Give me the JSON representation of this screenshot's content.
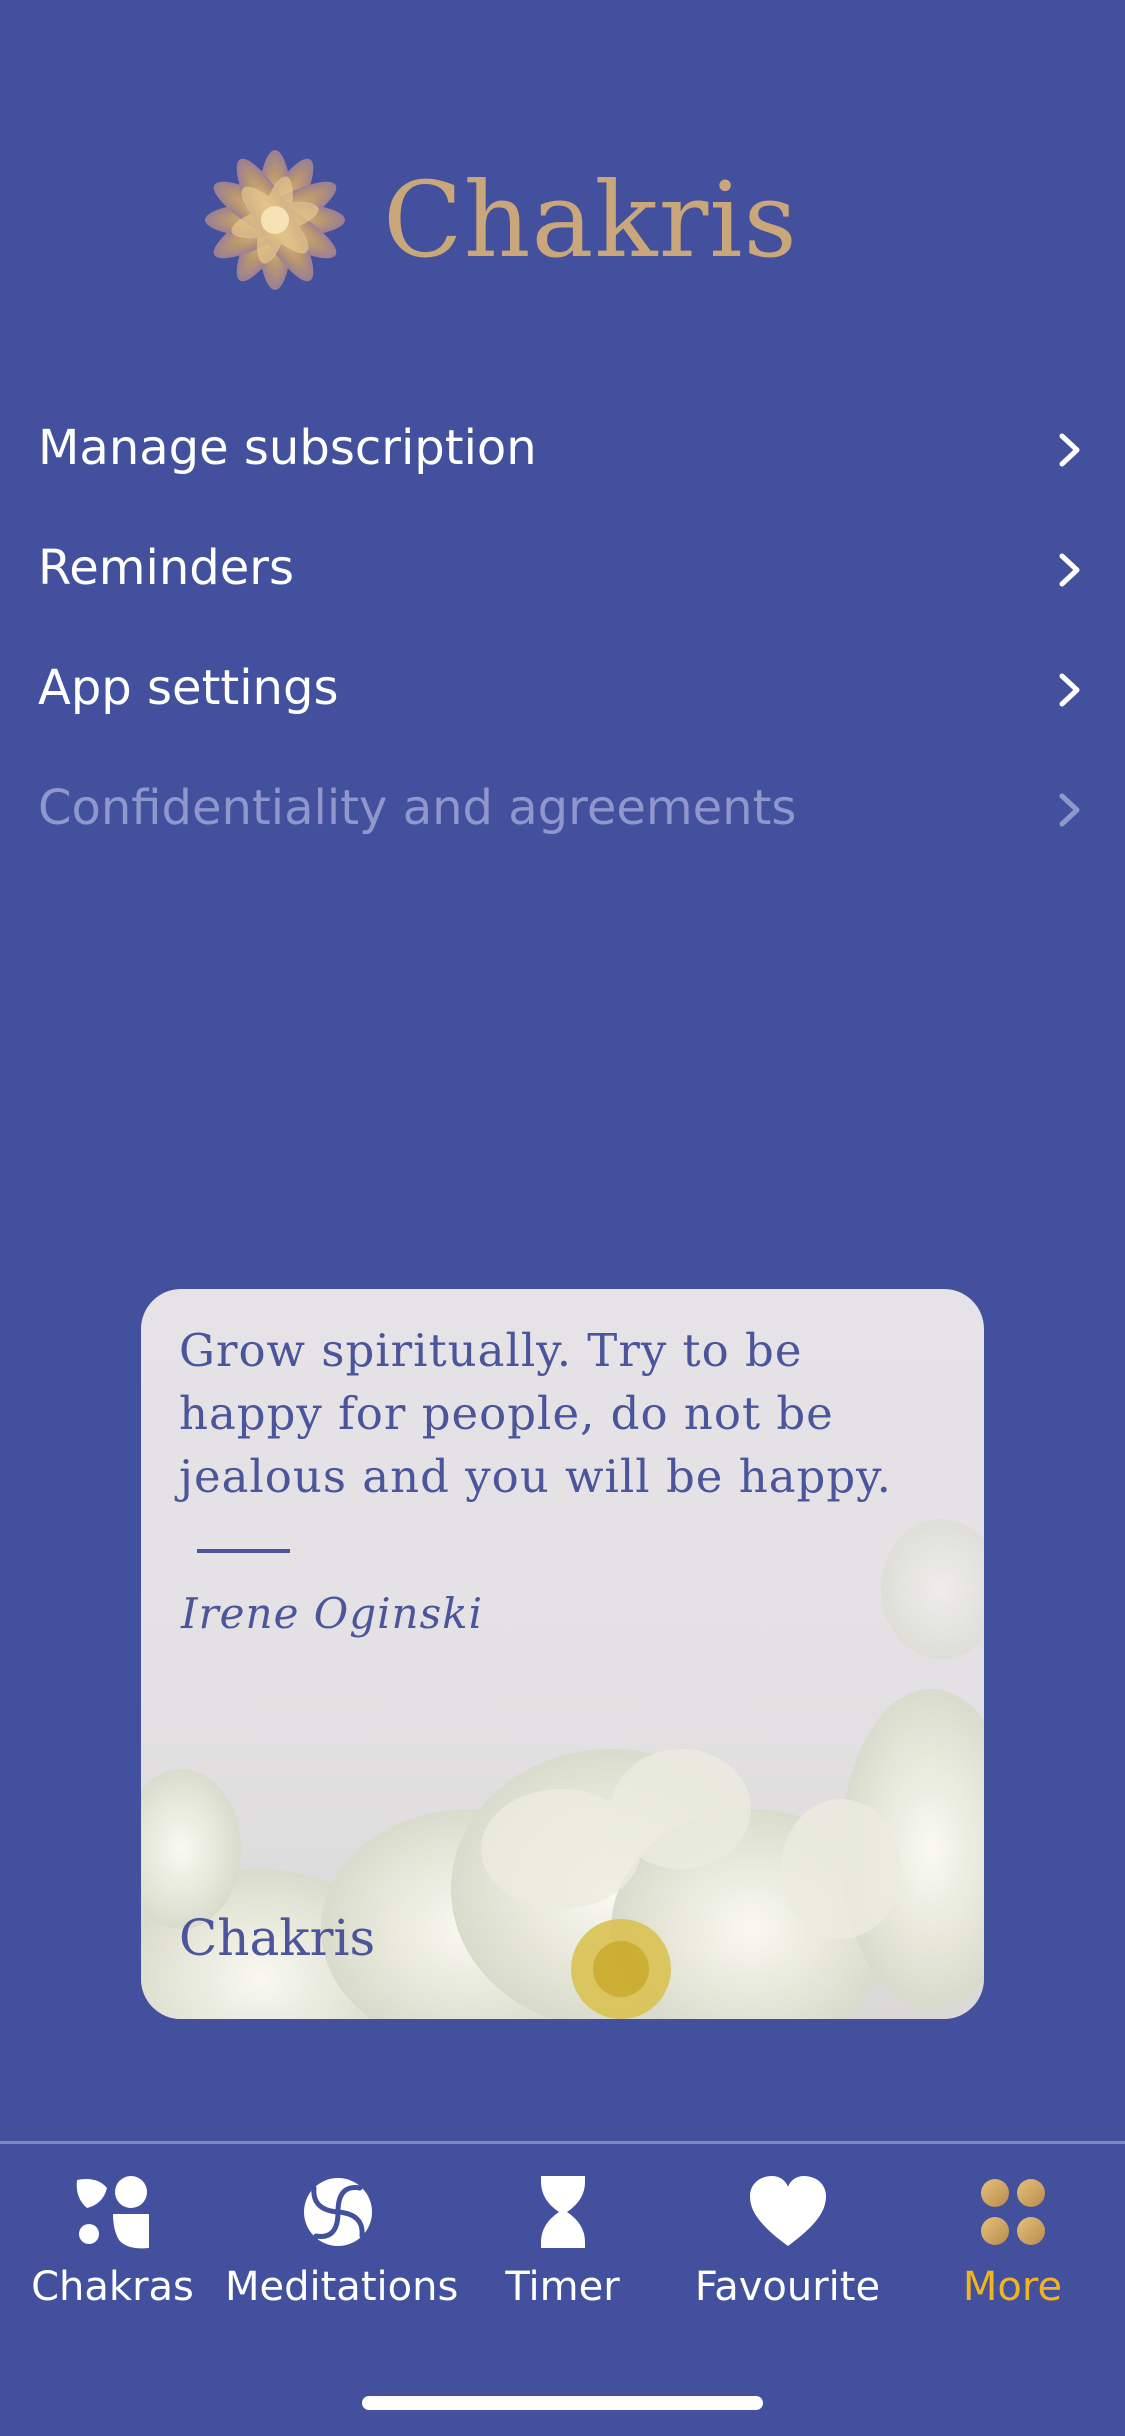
{
  "app": {
    "name": "Chakris",
    "logo_icon": "lotus-logo-icon",
    "brand_color": "#c9a77b",
    "background_color": "#43509d",
    "accent_color": "#f2b321"
  },
  "menu": {
    "items": [
      {
        "label": "Manage subscription",
        "enabled": true,
        "icon": "chevron-right-icon"
      },
      {
        "label": "Reminders",
        "enabled": true,
        "icon": "chevron-right-icon"
      },
      {
        "label": "App settings",
        "enabled": true,
        "icon": "chevron-right-icon"
      },
      {
        "label": "Confidentiality and agreements",
        "enabled": false,
        "icon": "chevron-right-icon"
      }
    ]
  },
  "quote": {
    "text": "Grow spiritually. Try to be happy for people, do not be jealous and you will be happy.",
    "author": "Irene Oginski",
    "brand": "Chakris"
  },
  "tabbar": {
    "tabs": [
      {
        "label": "Chakras",
        "icon": "chakras-icon",
        "active": false
      },
      {
        "label": "Meditations",
        "icon": "meditations-icon",
        "active": false
      },
      {
        "label": "Timer",
        "icon": "hourglass-icon",
        "active": false
      },
      {
        "label": "Favourite",
        "icon": "heart-icon",
        "active": false
      },
      {
        "label": "More",
        "icon": "more-grid-icon",
        "active": true
      }
    ]
  }
}
